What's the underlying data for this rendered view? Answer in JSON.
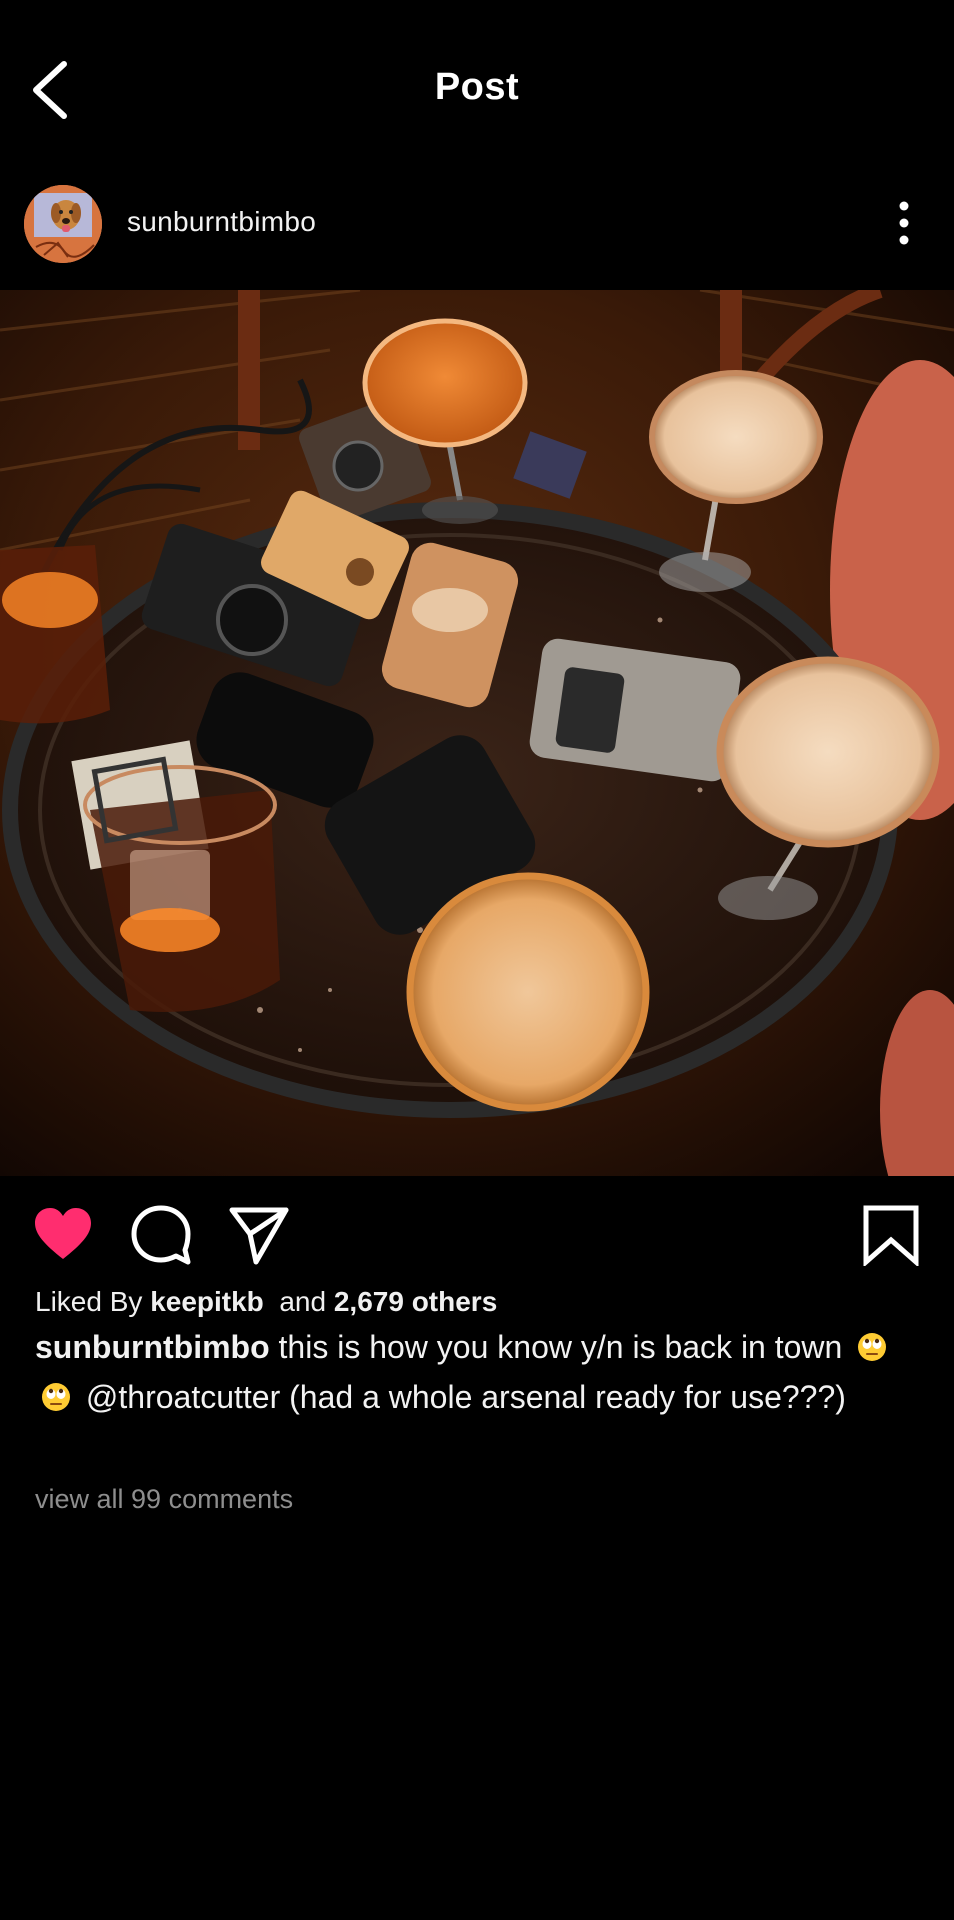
{
  "header": {
    "title": "Post",
    "back_icon": "chevron-left-icon"
  },
  "author": {
    "username": "sunburntbimbo",
    "more_icon": "more-vertical-icon"
  },
  "actions": {
    "like_icon": "heart-filled-icon",
    "comment_icon": "comment-icon",
    "share_icon": "send-icon",
    "save_icon": "bookmark-icon",
    "like_color": "#ff2d6f"
  },
  "likes": {
    "prefix": "Liked By",
    "user": "keepitkb",
    "middle": "and",
    "others": "2,679 others"
  },
  "caption": {
    "username": "sunburntbimbo",
    "text_part1": "this is how you know y/n is back in town",
    "emoji": "🙄",
    "text_part2": "@throatcutter (had a whole arsenal ready for use???)"
  },
  "comments": {
    "view_all": "view all 99 comments"
  },
  "colors": {
    "background": "#000000",
    "text": "#f2f2f2",
    "muted": "#8e8e8e"
  }
}
